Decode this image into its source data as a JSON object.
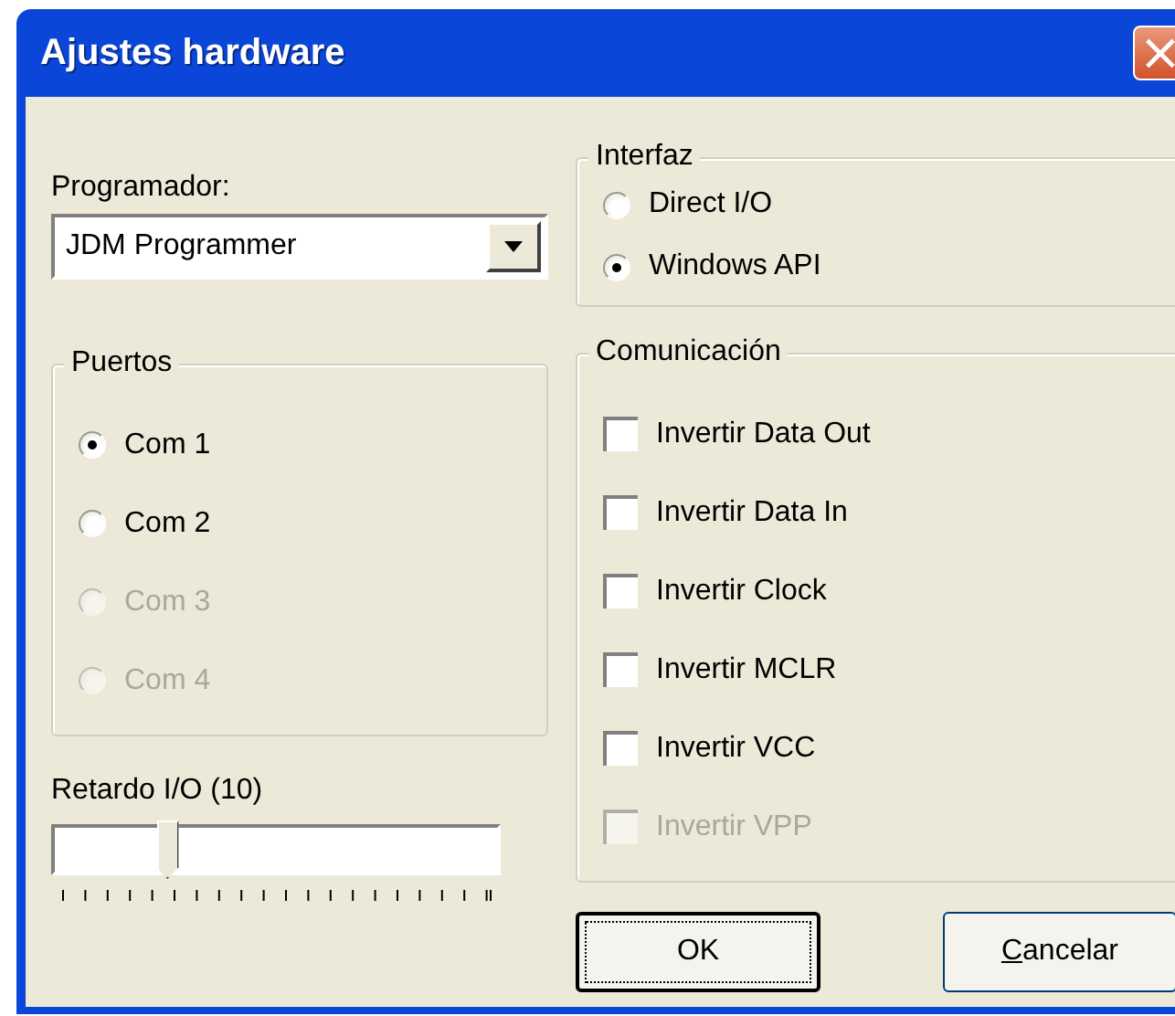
{
  "window": {
    "title": "Ajustes hardware",
    "close": "×"
  },
  "programmer": {
    "label": "Programador:",
    "value": "JDM Programmer"
  },
  "interface": {
    "title": "Interfaz",
    "options": [
      {
        "label": "Direct I/O",
        "selected": false,
        "disabled": false
      },
      {
        "label": "Windows API",
        "selected": true,
        "disabled": false
      }
    ]
  },
  "ports": {
    "title": "Puertos",
    "options": [
      {
        "label": "Com 1",
        "selected": true,
        "disabled": false
      },
      {
        "label": "Com 2",
        "selected": false,
        "disabled": false
      },
      {
        "label": "Com 3",
        "selected": false,
        "disabled": true
      },
      {
        "label": "Com 4",
        "selected": false,
        "disabled": true
      }
    ]
  },
  "delay": {
    "label": "Retardo I/O (10)",
    "level": 0.24
  },
  "communication": {
    "title": "Comunicación",
    "options": [
      {
        "label": "Invertir Data Out",
        "checked": false,
        "disabled": false
      },
      {
        "label": "Invertir Data In",
        "checked": false,
        "disabled": false
      },
      {
        "label": "Invertir Clock",
        "checked": false,
        "disabled": false
      },
      {
        "label": "Invertir MCLR",
        "checked": false,
        "disabled": false
      },
      {
        "label": "Invertir VCC",
        "checked": false,
        "disabled": false
      },
      {
        "label": "Invertir VPP",
        "checked": false,
        "disabled": true
      }
    ]
  },
  "buttons": [
    {
      "label": "OK",
      "default": true
    },
    {
      "label": "Cancelar",
      "default": false
    }
  ]
}
